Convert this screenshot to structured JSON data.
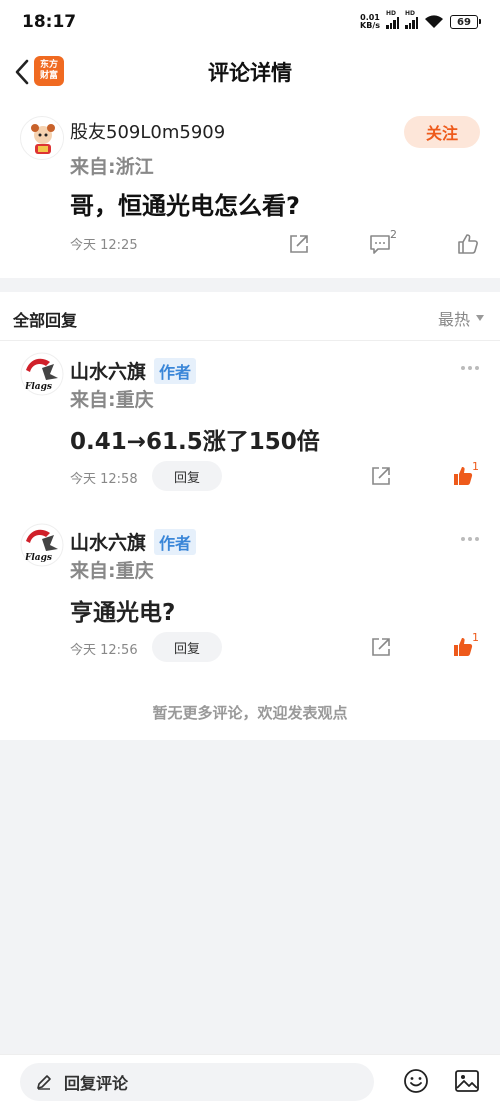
{
  "status_bar": {
    "time": "18:17",
    "net_speed_value": "0.01",
    "net_speed_unit": "KB/s",
    "signal_1_label": "HD",
    "signal_2_label": "HD",
    "battery": "69"
  },
  "header": {
    "title": "评论详情",
    "logo_line1": "东方",
    "logo_line2": "财富"
  },
  "post": {
    "author": "股友509L0m5909",
    "location": "来自:浙江",
    "text": "哥，恒通光电怎么看?",
    "time": "今天 12:25",
    "follow_label": "关注",
    "comment_count": "2"
  },
  "replies": {
    "header": "全部回复",
    "sort_label": "最热",
    "items": [
      {
        "author": "山水六旗",
        "tag": "作者",
        "location": "来自:重庆",
        "text": "0.41→61.5涨了150倍",
        "time": "今天 12:58",
        "reply_label": "回复",
        "likes": "1"
      },
      {
        "author": "山水六旗",
        "tag": "作者",
        "location": "来自:重庆",
        "text": "亨通光电?",
        "time": "今天 12:56",
        "reply_label": "回复",
        "likes": "1"
      }
    ],
    "no_more_text": "暂无更多评论，欢迎发表观点"
  },
  "bottom_bar": {
    "reply_placeholder": "回复评论"
  },
  "avatar_text": "Flags",
  "colors": {
    "accent": "#ee5a1b",
    "tag_blue": "#3a86d8",
    "muted": "#888888",
    "page_bg": "#f2f3f5"
  }
}
